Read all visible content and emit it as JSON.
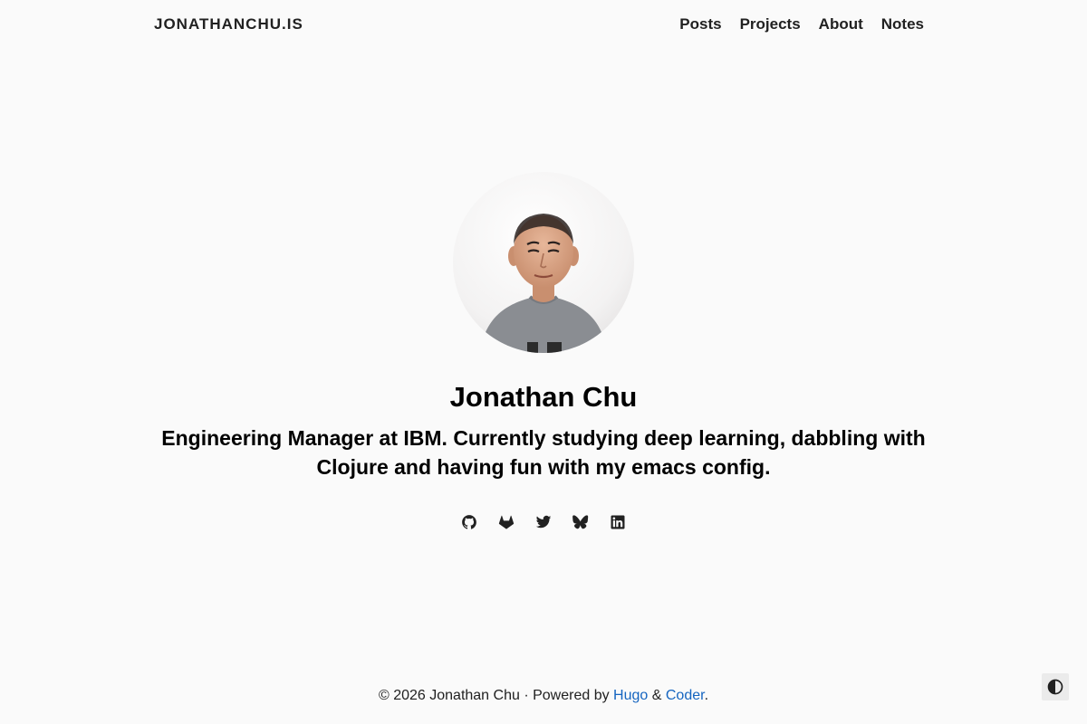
{
  "header": {
    "brand": "JONATHANCHU.IS",
    "nav": [
      {
        "label": "Posts"
      },
      {
        "label": "Projects"
      },
      {
        "label": "About"
      },
      {
        "label": "Notes"
      }
    ]
  },
  "profile": {
    "avatar_icon": "profile-photo",
    "name": "Jonathan Chu",
    "tagline": "Engineering Manager at IBM. Currently studying deep learning, dabbling with Clojure and having fun with my emacs config."
  },
  "social": [
    {
      "icon": "github-icon"
    },
    {
      "icon": "gitlab-icon"
    },
    {
      "icon": "twitter-icon"
    },
    {
      "icon": "bluesky-icon"
    },
    {
      "icon": "linkedin-icon"
    }
  ],
  "footer": {
    "copyright": "© 2026 Jonathan Chu",
    "separator": " · ",
    "powered_by": "Powered by",
    "hugo_link": "Hugo",
    "amp": "&",
    "coder_link": "Coder",
    "period": "."
  },
  "theme_toggle": {
    "icon": "contrast-icon"
  },
  "colors": {
    "background": "#fafafa",
    "text": "#212121",
    "link": "#1565c0",
    "toggle_bg": "#ebebeb"
  }
}
